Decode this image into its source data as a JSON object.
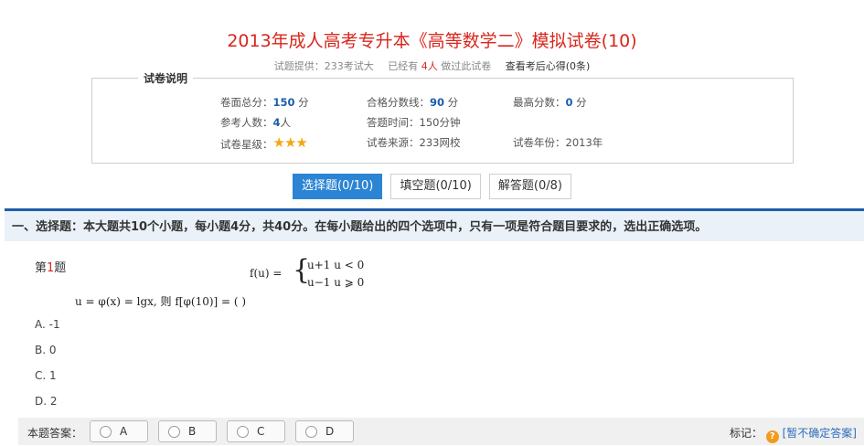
{
  "page": {
    "title": "2013年成人高考专升本《高等数学二》模拟试卷(10)"
  },
  "meta": {
    "provider": "试题提供：233考试大",
    "done_prefix": "已经有",
    "done_count": "4人",
    "done_suffix": "做过此试卷",
    "notes_link": "查看考后心得(0条)"
  },
  "info": {
    "legend": "试卷说明",
    "total_label": "卷面总分：",
    "total_value": "150",
    "total_unit": "分",
    "pass_label": "合格分数线：",
    "pass_value": "90",
    "pass_unit": "分",
    "max_label": "最高分数：",
    "max_value": "0",
    "max_unit": "分",
    "takers_label": "参考人数：",
    "takers_value": "4",
    "takers_unit": "人",
    "time": "答题时间：150分钟",
    "stars_label": "试卷星级：",
    "stars": "★★★",
    "source": "试卷来源：233网校",
    "year": "试卷年份：2013年"
  },
  "tabs": [
    {
      "label": "选择题(0/10)"
    },
    {
      "label": "填空题(0/10)"
    },
    {
      "label": "解答题(0/8)"
    }
  ],
  "section": {
    "heading": "一、选择题：本大题共10个小题，每小题4分，共40分。在每小题给出的四个选项中，只有一项是符合题目要求的，选出正确选项。"
  },
  "question": {
    "prefix": "第",
    "number": "1",
    "suffix": "题",
    "formula_lhs": "f(u) =",
    "case1": "u+1   u < 0",
    "case2": "u−1   u ⩾ 0",
    "stem": "u = φ(x) = lgx, 则 f[φ(10)] = (     )",
    "options": [
      "A. -1",
      "B. 0",
      "C. 1",
      "D. 2"
    ]
  },
  "answer_bar": {
    "label": "本题答案：",
    "choices": [
      "A",
      "B",
      "C",
      "D"
    ],
    "mark_label": "标记：",
    "mark_icon": "?",
    "mark_link": "[暂不确定答案]"
  }
}
